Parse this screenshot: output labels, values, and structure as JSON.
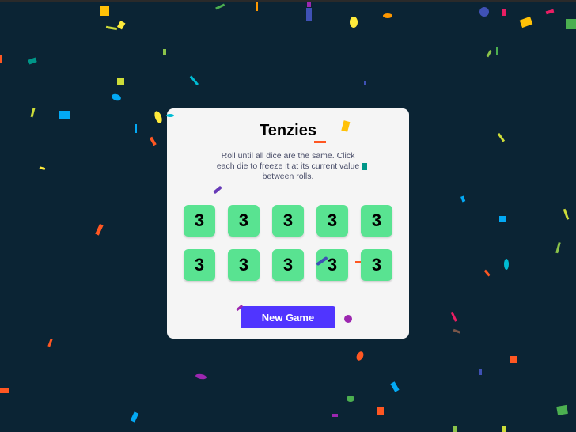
{
  "game": {
    "title": "Tenzies",
    "instructions": "Roll until all dice are the same. Click each die to freeze it at its current value between rolls.",
    "dice": [
      {
        "value": "3",
        "held": true
      },
      {
        "value": "3",
        "held": true
      },
      {
        "value": "3",
        "held": true
      },
      {
        "value": "3",
        "held": true
      },
      {
        "value": "3",
        "held": true
      },
      {
        "value": "3",
        "held": true
      },
      {
        "value": "3",
        "held": true
      },
      {
        "value": "3",
        "held": true
      },
      {
        "value": "3",
        "held": true
      },
      {
        "value": "3",
        "held": true
      }
    ],
    "button_label": "New Game"
  },
  "colors": {
    "background": "#0b2434",
    "card": "#f5f5f5",
    "held_die": "#59e391",
    "button": "#5035ff",
    "title": "#000000",
    "instructions": "#4a4e69"
  }
}
